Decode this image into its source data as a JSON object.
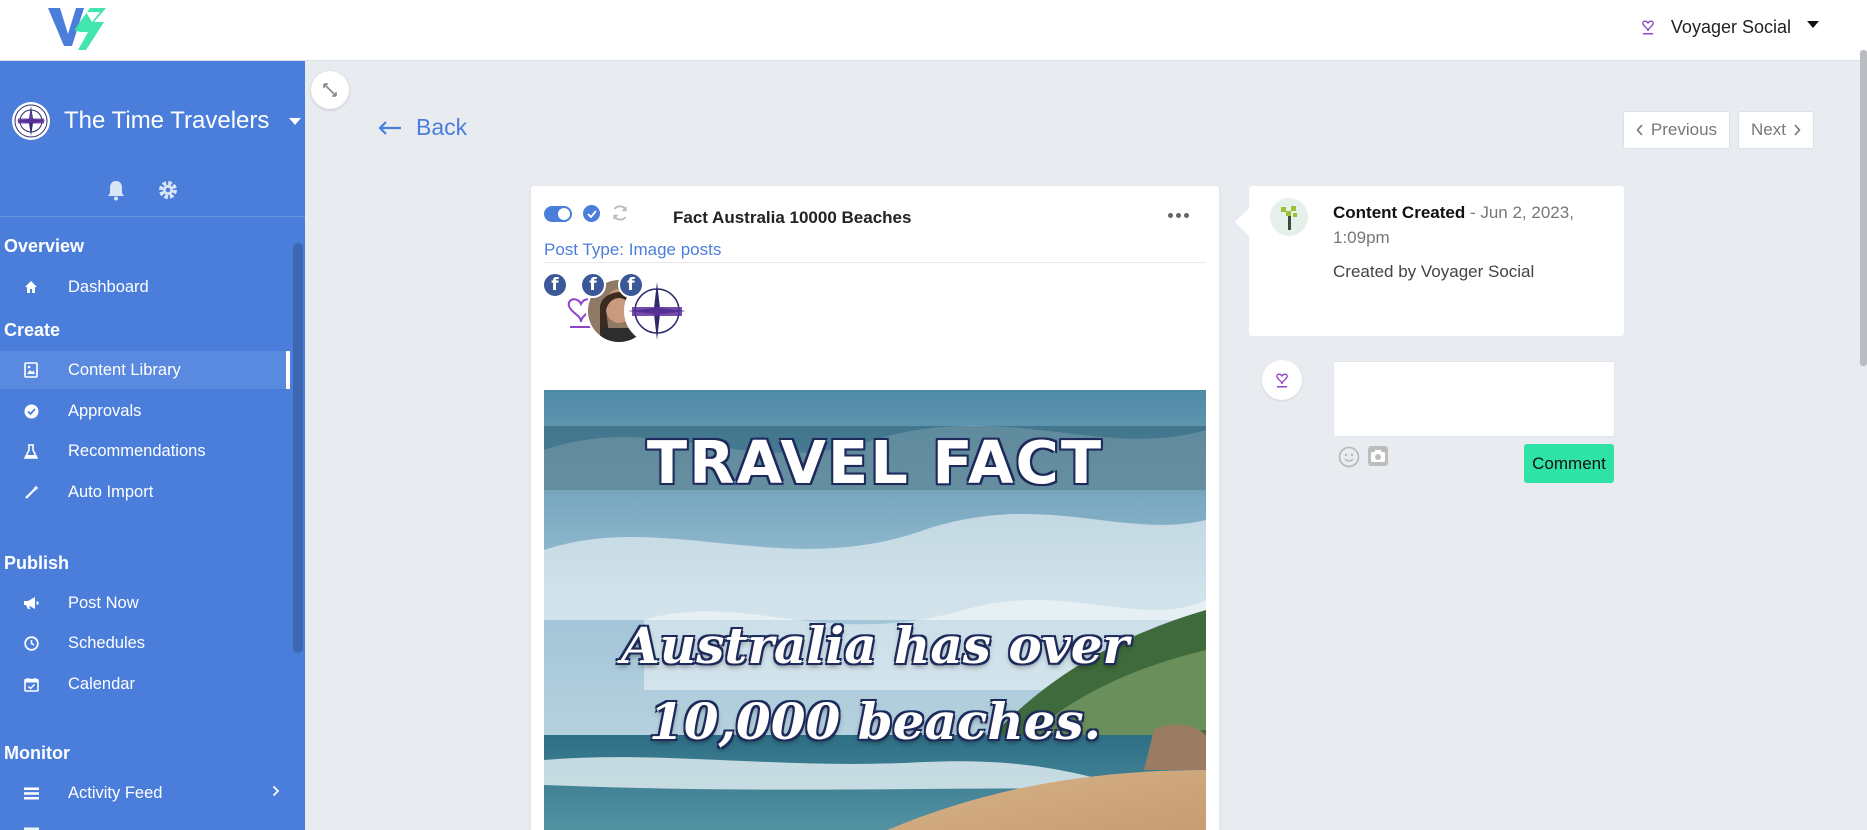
{
  "topbar": {
    "account_name": "Voyager Social"
  },
  "sidebar": {
    "brand_name": "The Time Travelers",
    "sections": {
      "overview": "Overview",
      "create": "Create",
      "publish": "Publish",
      "monitor": "Monitor"
    },
    "items": [
      {
        "label": "Dashboard",
        "icon": "home-icon"
      },
      {
        "label": "Content Library",
        "icon": "image-file-icon",
        "active": true
      },
      {
        "label": "Approvals",
        "icon": "check-circle-icon"
      },
      {
        "label": "Recommendations",
        "icon": "flask-icon"
      },
      {
        "label": "Auto Import",
        "icon": "magic-wand-icon"
      },
      {
        "label": "Post Now",
        "icon": "megaphone-icon"
      },
      {
        "label": "Schedules",
        "icon": "clock-icon"
      },
      {
        "label": "Calendar",
        "icon": "calendar-check-icon"
      },
      {
        "label": "Activity Feed",
        "icon": "list-icon"
      }
    ]
  },
  "nav": {
    "back_label": "Back",
    "previous_label": "Previous",
    "next_label": "Next"
  },
  "post": {
    "title": "Fact Australia 10000 Beaches",
    "post_type": "Post Type: Image posts",
    "network_badge": "f",
    "image_heading": "TRAVEL FACT",
    "image_line1": "Australia has over",
    "image_line2": "10,000 beaches."
  },
  "activity": {
    "event": "Content Created",
    "date": " - Jun 2, 2023, 1:09pm",
    "body": "Created by Voyager Social"
  },
  "comment": {
    "button_label": "Comment",
    "value": ""
  },
  "colors": {
    "sidebar_bg": "#4b7ddb",
    "accent": "#4b7ddb",
    "comment_button": "#2fe2a6",
    "facebook": "#3b5998"
  }
}
